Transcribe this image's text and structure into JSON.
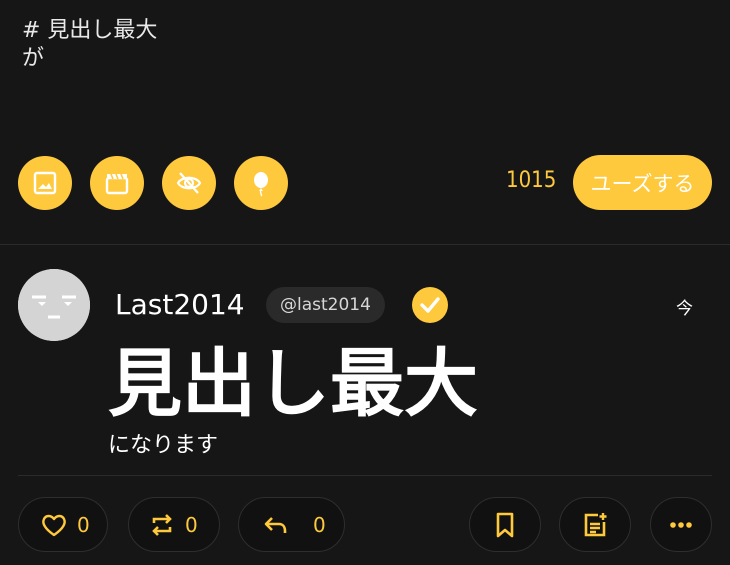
{
  "composer": {
    "draft_line1": "# 見出し最大",
    "draft_line2": "が",
    "char_count": "1015",
    "submit_label": "ユーズする"
  },
  "post": {
    "username": "Last2014",
    "handle": "@last2014",
    "time": "今",
    "headline": "見出し最大",
    "subline": "になります"
  },
  "actions": {
    "like_count": "0",
    "repost_count": "0",
    "reply_count": "0"
  },
  "colors": {
    "accent": "#ffc93d",
    "background": "#161616"
  }
}
